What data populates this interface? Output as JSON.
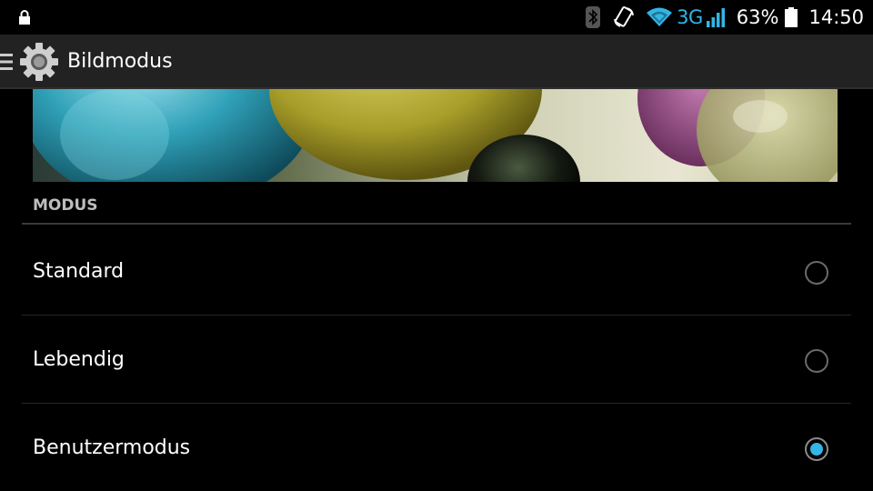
{
  "status_bar": {
    "icons": [
      "lock-icon",
      "bluetooth-icon",
      "screen-rotation-icon",
      "wifi-icon",
      "signal-icon",
      "battery-icon"
    ],
    "network_type": "3G",
    "battery_percent": "63%",
    "time": "14:50",
    "accent_color": "#33b5e5"
  },
  "action_bar": {
    "title": "Bildmodus",
    "icons": [
      "menu-icon",
      "settings-gear-icon"
    ]
  },
  "section": {
    "header": "MODUS"
  },
  "options": [
    {
      "label": "Standard",
      "selected": false
    },
    {
      "label": "Lebendig",
      "selected": false
    },
    {
      "label": "Benutzermodus",
      "selected": true
    }
  ]
}
